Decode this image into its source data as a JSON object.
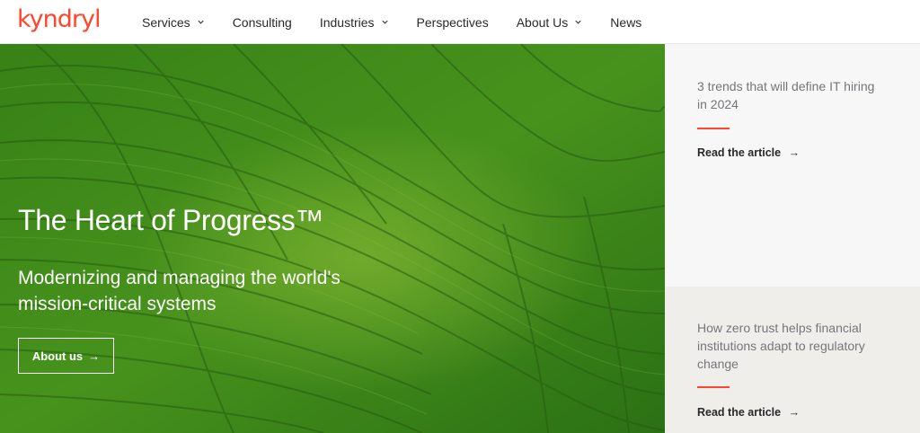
{
  "brand": {
    "name": "kyndryl",
    "accent": "#ff462d"
  },
  "nav": {
    "items": [
      {
        "label": "Services",
        "has_dropdown": true
      },
      {
        "label": "Consulting",
        "has_dropdown": false
      },
      {
        "label": "Industries",
        "has_dropdown": true
      },
      {
        "label": "Perspectives",
        "has_dropdown": false
      },
      {
        "label": "About Us",
        "has_dropdown": true
      },
      {
        "label": "News",
        "has_dropdown": false
      }
    ],
    "dropdown_icon": "chevron-down-icon"
  },
  "hero": {
    "title": "The Heart of Progress™",
    "subtitle": "Modernizing and managing the world's mission-critical systems",
    "button_label": "About us",
    "button_icon": "arrow-right-icon",
    "background": "aerial green rice field terraces",
    "colors": {
      "field_dark": "#2f7a16",
      "field_mid": "#4a9a1e",
      "field_light": "#7fbf2e"
    }
  },
  "side_cards": [
    {
      "text": "3 trends that will define IT hiring in 2024",
      "link_label": "Read the article",
      "background": "#f7f7f8"
    },
    {
      "text": "How zero trust helps financial institutions adapt to regulatory change",
      "link_label": "Read the article",
      "background": "#f0eeeb"
    }
  ]
}
